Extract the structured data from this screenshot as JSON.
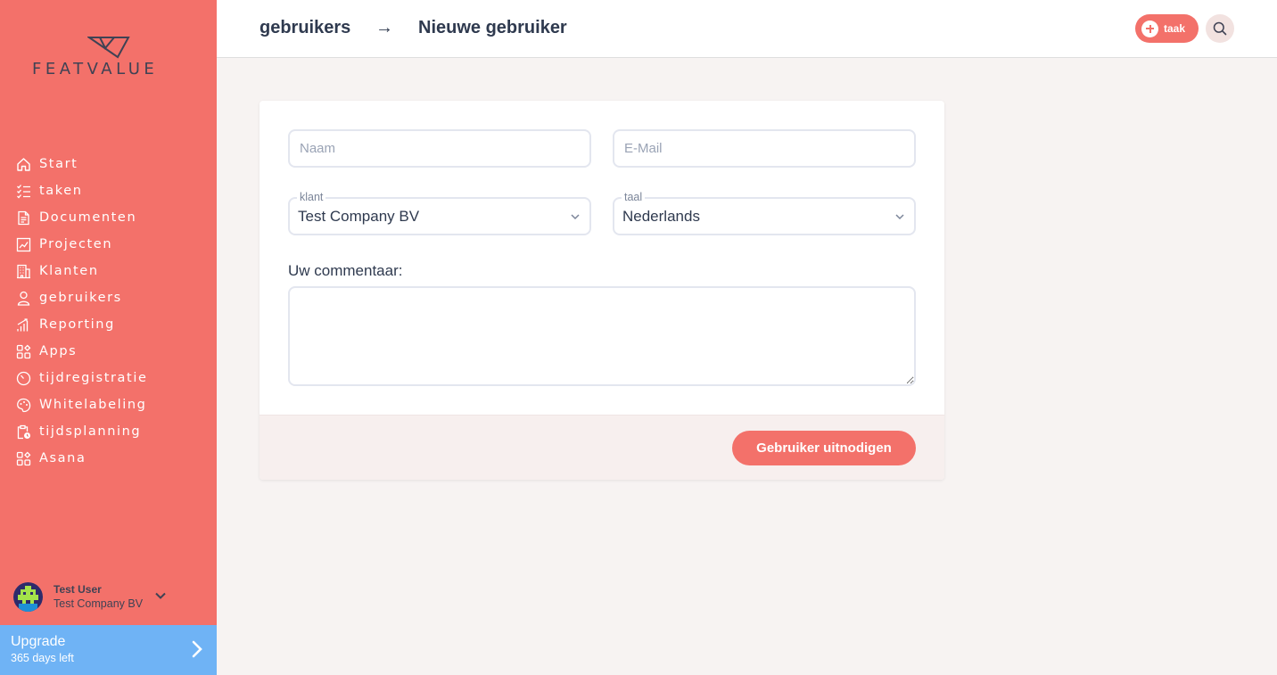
{
  "brand": {
    "name": "FEATVALUE",
    "accent": "#f3716a",
    "upgrade_color": "#6fb3f5"
  },
  "sidebar": {
    "items": [
      {
        "label": "Start",
        "icon": "home-icon"
      },
      {
        "label": "taken",
        "icon": "tasks-icon"
      },
      {
        "label": "Documenten",
        "icon": "document-icon"
      },
      {
        "label": "Projecten",
        "icon": "chart-icon"
      },
      {
        "label": "Klanten",
        "icon": "building-icon"
      },
      {
        "label": "gebruikers",
        "icon": "user-icon"
      },
      {
        "label": "Reporting",
        "icon": "bar-chart-icon"
      },
      {
        "label": "Apps",
        "icon": "apps-icon"
      },
      {
        "label": "tijdregistratie",
        "icon": "timer-icon"
      },
      {
        "label": "Whitelabeling",
        "icon": "palette-icon"
      },
      {
        "label": "tijdsplanning",
        "icon": "clipboard-clock-icon"
      },
      {
        "label": "Asana",
        "icon": "apps-icon"
      }
    ],
    "user": {
      "name": "Test User",
      "company": "Test Company BV"
    },
    "upgrade": {
      "title": "Upgrade",
      "subtitle": "365 days left"
    }
  },
  "header": {
    "breadcrumb_parent": "gebruikers",
    "breadcrumb_arrow": "→",
    "breadcrumb_current": "Nieuwe gebruiker",
    "task_button_label": "taak"
  },
  "form": {
    "name_placeholder": "Naam",
    "email_placeholder": "E-Mail",
    "client_label": "klant",
    "client_value": "Test Company BV",
    "language_label": "taal",
    "language_value": "Nederlands",
    "comment_label": "Uw commentaar:",
    "submit_label": "Gebruiker uitnodigen"
  }
}
